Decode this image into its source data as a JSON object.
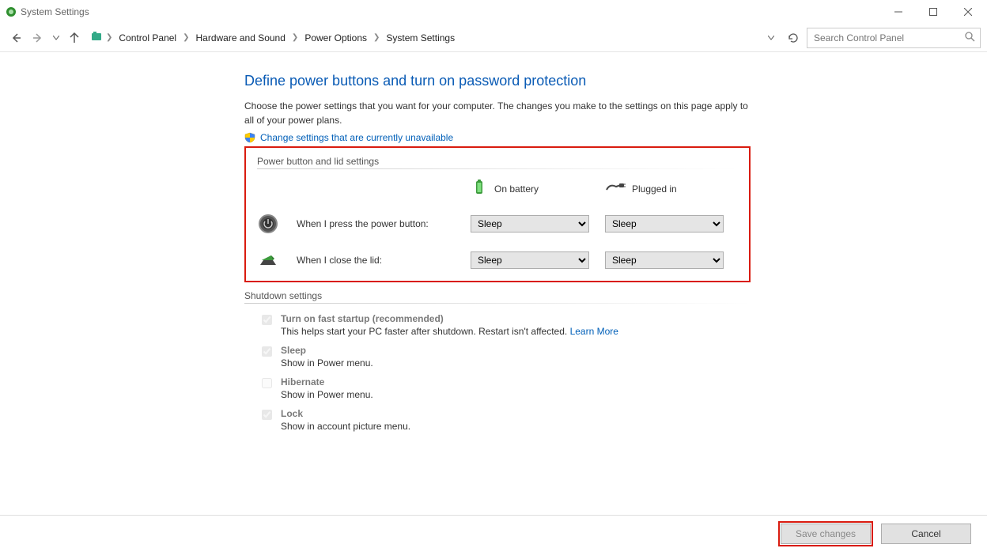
{
  "window": {
    "title": "System Settings"
  },
  "breadcrumb": {
    "items": [
      "Control Panel",
      "Hardware and Sound",
      "Power Options",
      "System Settings"
    ]
  },
  "search": {
    "placeholder": "Search Control Panel"
  },
  "page": {
    "title": "Define power buttons and turn on password protection",
    "description": "Choose the power settings that you want for your computer. The changes you make to the settings on this page apply to all of your power plans.",
    "admin_link": "Change settings that are currently unavailable"
  },
  "groups": {
    "power_label": "Power button and lid settings",
    "shutdown_label": "Shutdown settings"
  },
  "columns": {
    "battery": "On battery",
    "plugged": "Plugged in"
  },
  "rows": {
    "power_button": {
      "label": "When I press the power button:",
      "battery_value": "Sleep",
      "plugged_value": "Sleep"
    },
    "close_lid": {
      "label": "When I close the lid:",
      "battery_value": "Sleep",
      "plugged_value": "Sleep"
    }
  },
  "shutdown": {
    "fast_startup": {
      "title": "Turn on fast startup (recommended)",
      "desc_prefix": "This helps start your PC faster after shutdown. Restart isn't affected. ",
      "learn_more": "Learn More"
    },
    "sleep": {
      "title": "Sleep",
      "desc": "Show in Power menu."
    },
    "hibernate": {
      "title": "Hibernate",
      "desc": "Show in Power menu."
    },
    "lock": {
      "title": "Lock",
      "desc": "Show in account picture menu."
    }
  },
  "buttons": {
    "save": "Save changes",
    "cancel": "Cancel"
  }
}
